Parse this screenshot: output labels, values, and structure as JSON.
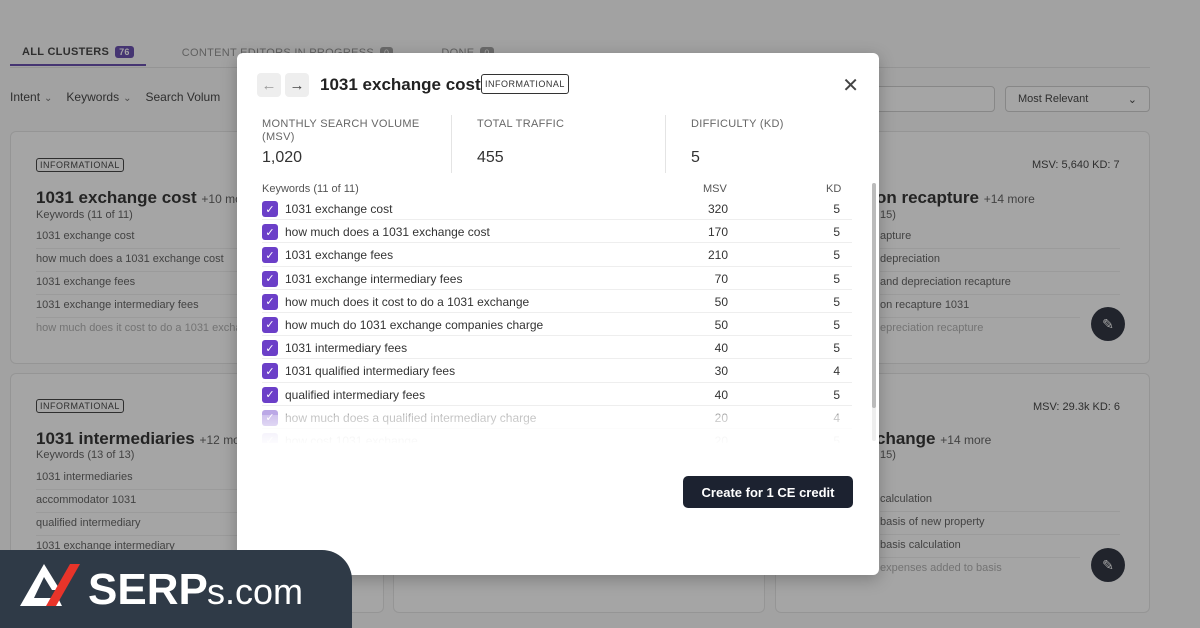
{
  "background": {
    "tabs": [
      {
        "label": "ALL CLUSTERS",
        "count": "76"
      },
      {
        "label": "CONTENT EDITORS IN PROGRESS",
        "count": "0"
      },
      {
        "label": "DONE",
        "count": "0"
      }
    ],
    "filters": [
      "Intent",
      "Keywords",
      "Search Volum"
    ],
    "sort": "Most Relevant",
    "cards": [
      {
        "badge": "INFORMATIONAL",
        "title": "1031 exchange cost",
        "more": "+10 mo",
        "subtitle": "Keywords (11 of 11)",
        "rows": [
          "1031 exchange cost",
          "how much does a 1031 exchange cost",
          "1031 exchange fees",
          "1031 exchange intermediary fees",
          "how much does it cost to do a 1031 exchang"
        ]
      },
      {
        "badge": "INFORMATIONAL",
        "title": "1031 intermediaries",
        "more": "+12 mor",
        "subtitle": "Keywords (13 of 13)",
        "rows": [
          "1031 intermediaries",
          "accommodator 1031",
          "qualified intermediary",
          "1031 exchange intermediary"
        ]
      },
      {
        "title": "on recapture",
        "more": "+14 more",
        "subtitle": "15)",
        "metrics": "MSV: 5,640   KD: 7",
        "rows": [
          "apture",
          "depreciation",
          "and depreciation recapture",
          "on recapture 1031",
          "epreciation recapture"
        ]
      },
      {
        "title": "change",
        "more": "+14 more",
        "subtitle": "15)",
        "metrics": "MSV: 29.3k   KD: 6",
        "rows": [
          "calculation",
          "basis of new property",
          "basis calculation",
          "expenses added to basis"
        ]
      }
    ]
  },
  "modal": {
    "title": "1031 exchange cost",
    "badge": "INFORMATIONAL",
    "stats": [
      {
        "label": "MONTHLY SEARCH VOLUME (MSV)",
        "value": "1,020"
      },
      {
        "label": "TOTAL TRAFFIC",
        "value": "455"
      },
      {
        "label": "DIFFICULTY (KD)",
        "value": "5"
      }
    ],
    "keywords_header": "Keywords (11 of 11)",
    "col_msv": "MSV",
    "col_kd": "KD",
    "keywords": [
      {
        "keyword": "1031 exchange cost",
        "msv": "320",
        "kd": "5"
      },
      {
        "keyword": "how much does a 1031 exchange cost",
        "msv": "170",
        "kd": "5"
      },
      {
        "keyword": "1031 exchange fees",
        "msv": "210",
        "kd": "5"
      },
      {
        "keyword": "1031 exchange intermediary fees",
        "msv": "70",
        "kd": "5"
      },
      {
        "keyword": "how much does it cost to do a 1031 exchange",
        "msv": "50",
        "kd": "5"
      },
      {
        "keyword": "how much do 1031 exchange companies charge",
        "msv": "50",
        "kd": "5"
      },
      {
        "keyword": "1031 intermediary fees",
        "msv": "40",
        "kd": "5"
      },
      {
        "keyword": "1031 qualified intermediary fees",
        "msv": "30",
        "kd": "4"
      },
      {
        "keyword": "qualified intermediary fees",
        "msv": "40",
        "kd": "5"
      },
      {
        "keyword": "how much does a qualified intermediary charge",
        "msv": "20",
        "kd": "4"
      },
      {
        "keyword": "how cost 1031 exchange",
        "msv": "20",
        "kd": "5"
      }
    ],
    "create_button": "Create for 1 CE credit"
  },
  "logo": {
    "text": "SERPs.com"
  },
  "colors": {
    "accent": "#6b3fc8",
    "dark_button": "#1c2230",
    "logo_bg": "#2f3a47",
    "logo_red": "#e8342a"
  },
  "icons": [
    "arrow-left-icon",
    "arrow-right-icon",
    "close-icon",
    "checkbox-checked-icon",
    "edit-pencil-icon",
    "chevron-down-icon"
  ]
}
